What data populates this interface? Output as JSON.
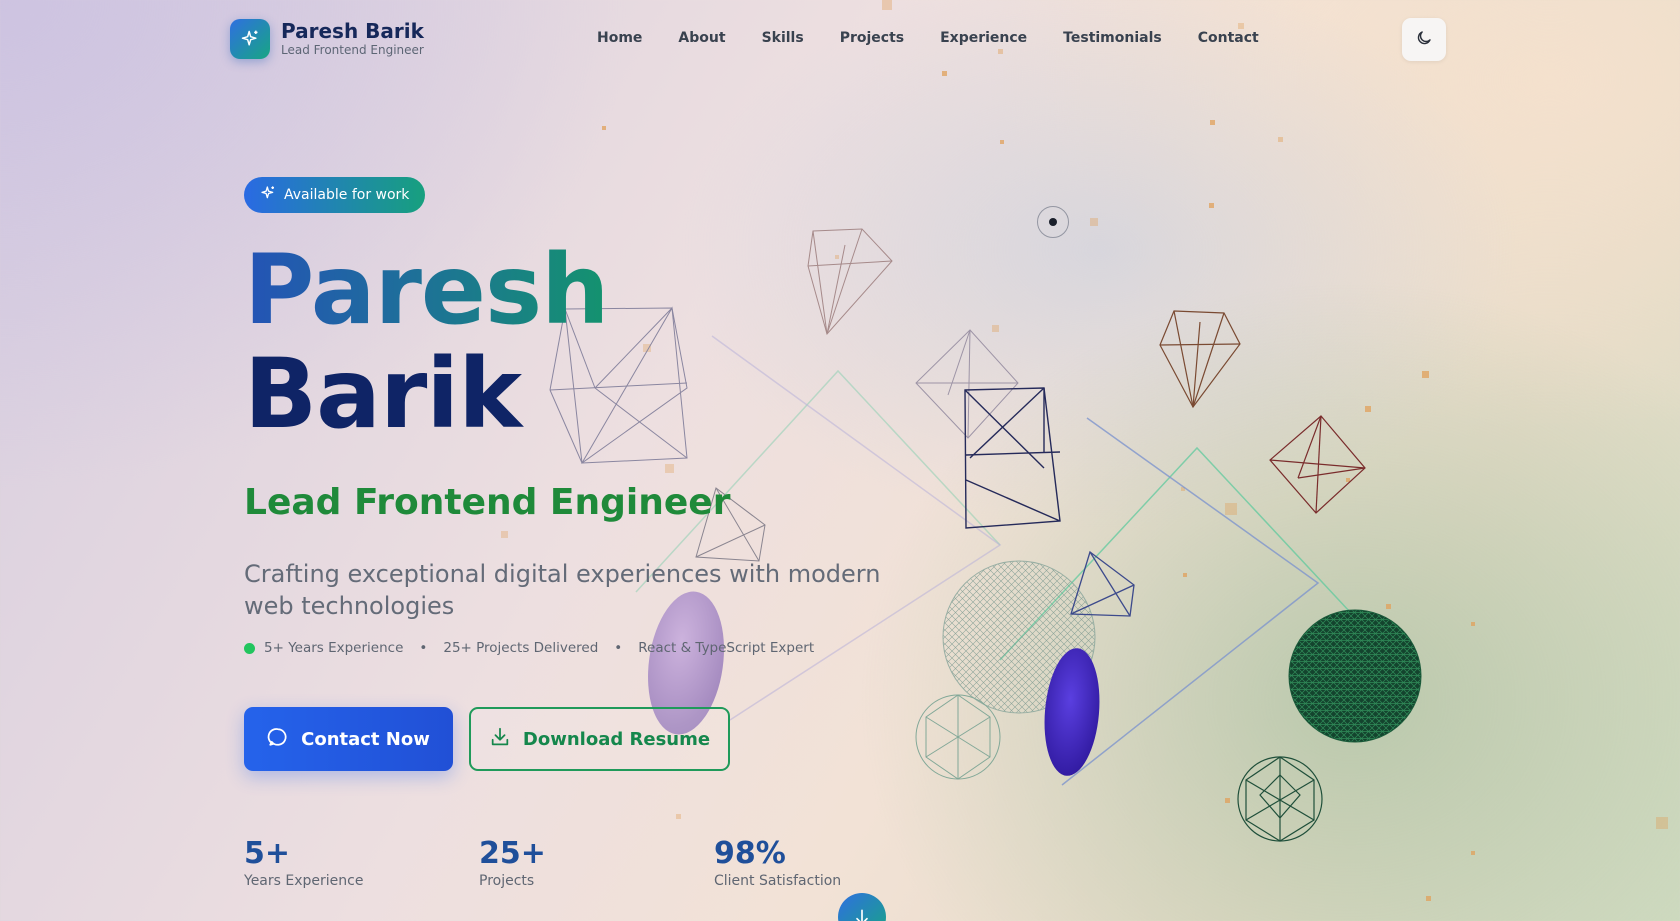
{
  "brand": {
    "name": "Paresh Barik",
    "subtitle": "Lead Frontend Engineer",
    "icon": "sparkles-icon"
  },
  "nav": {
    "items": [
      {
        "label": "Home"
      },
      {
        "label": "About"
      },
      {
        "label": "Skills"
      },
      {
        "label": "Projects"
      },
      {
        "label": "Experience"
      },
      {
        "label": "Testimonials"
      },
      {
        "label": "Contact"
      }
    ],
    "theme_toggle_icon": "moon-icon"
  },
  "hero": {
    "badge": "Available for work",
    "first_name": "Paresh",
    "last_name": "Barik",
    "role": "Lead Frontend Engineer",
    "tagline": "Crafting exceptional digital experiences with modern web technologies",
    "highlights": [
      "5+ Years Experience",
      "25+ Projects Delivered",
      "React & TypeScript Expert"
    ],
    "primary_button": "Contact Now",
    "secondary_button": "Download Resume"
  },
  "stats": [
    {
      "value": "5+",
      "label": "Years Experience"
    },
    {
      "value": "25+",
      "label": "Projects"
    },
    {
      "value": "98%",
      "label": "Client Satisfaction"
    }
  ],
  "colors": {
    "primary": "#2563eb",
    "accent_green": "#1f8a3a",
    "name_dark": "#0f2466",
    "status_green": "#22c55e"
  }
}
